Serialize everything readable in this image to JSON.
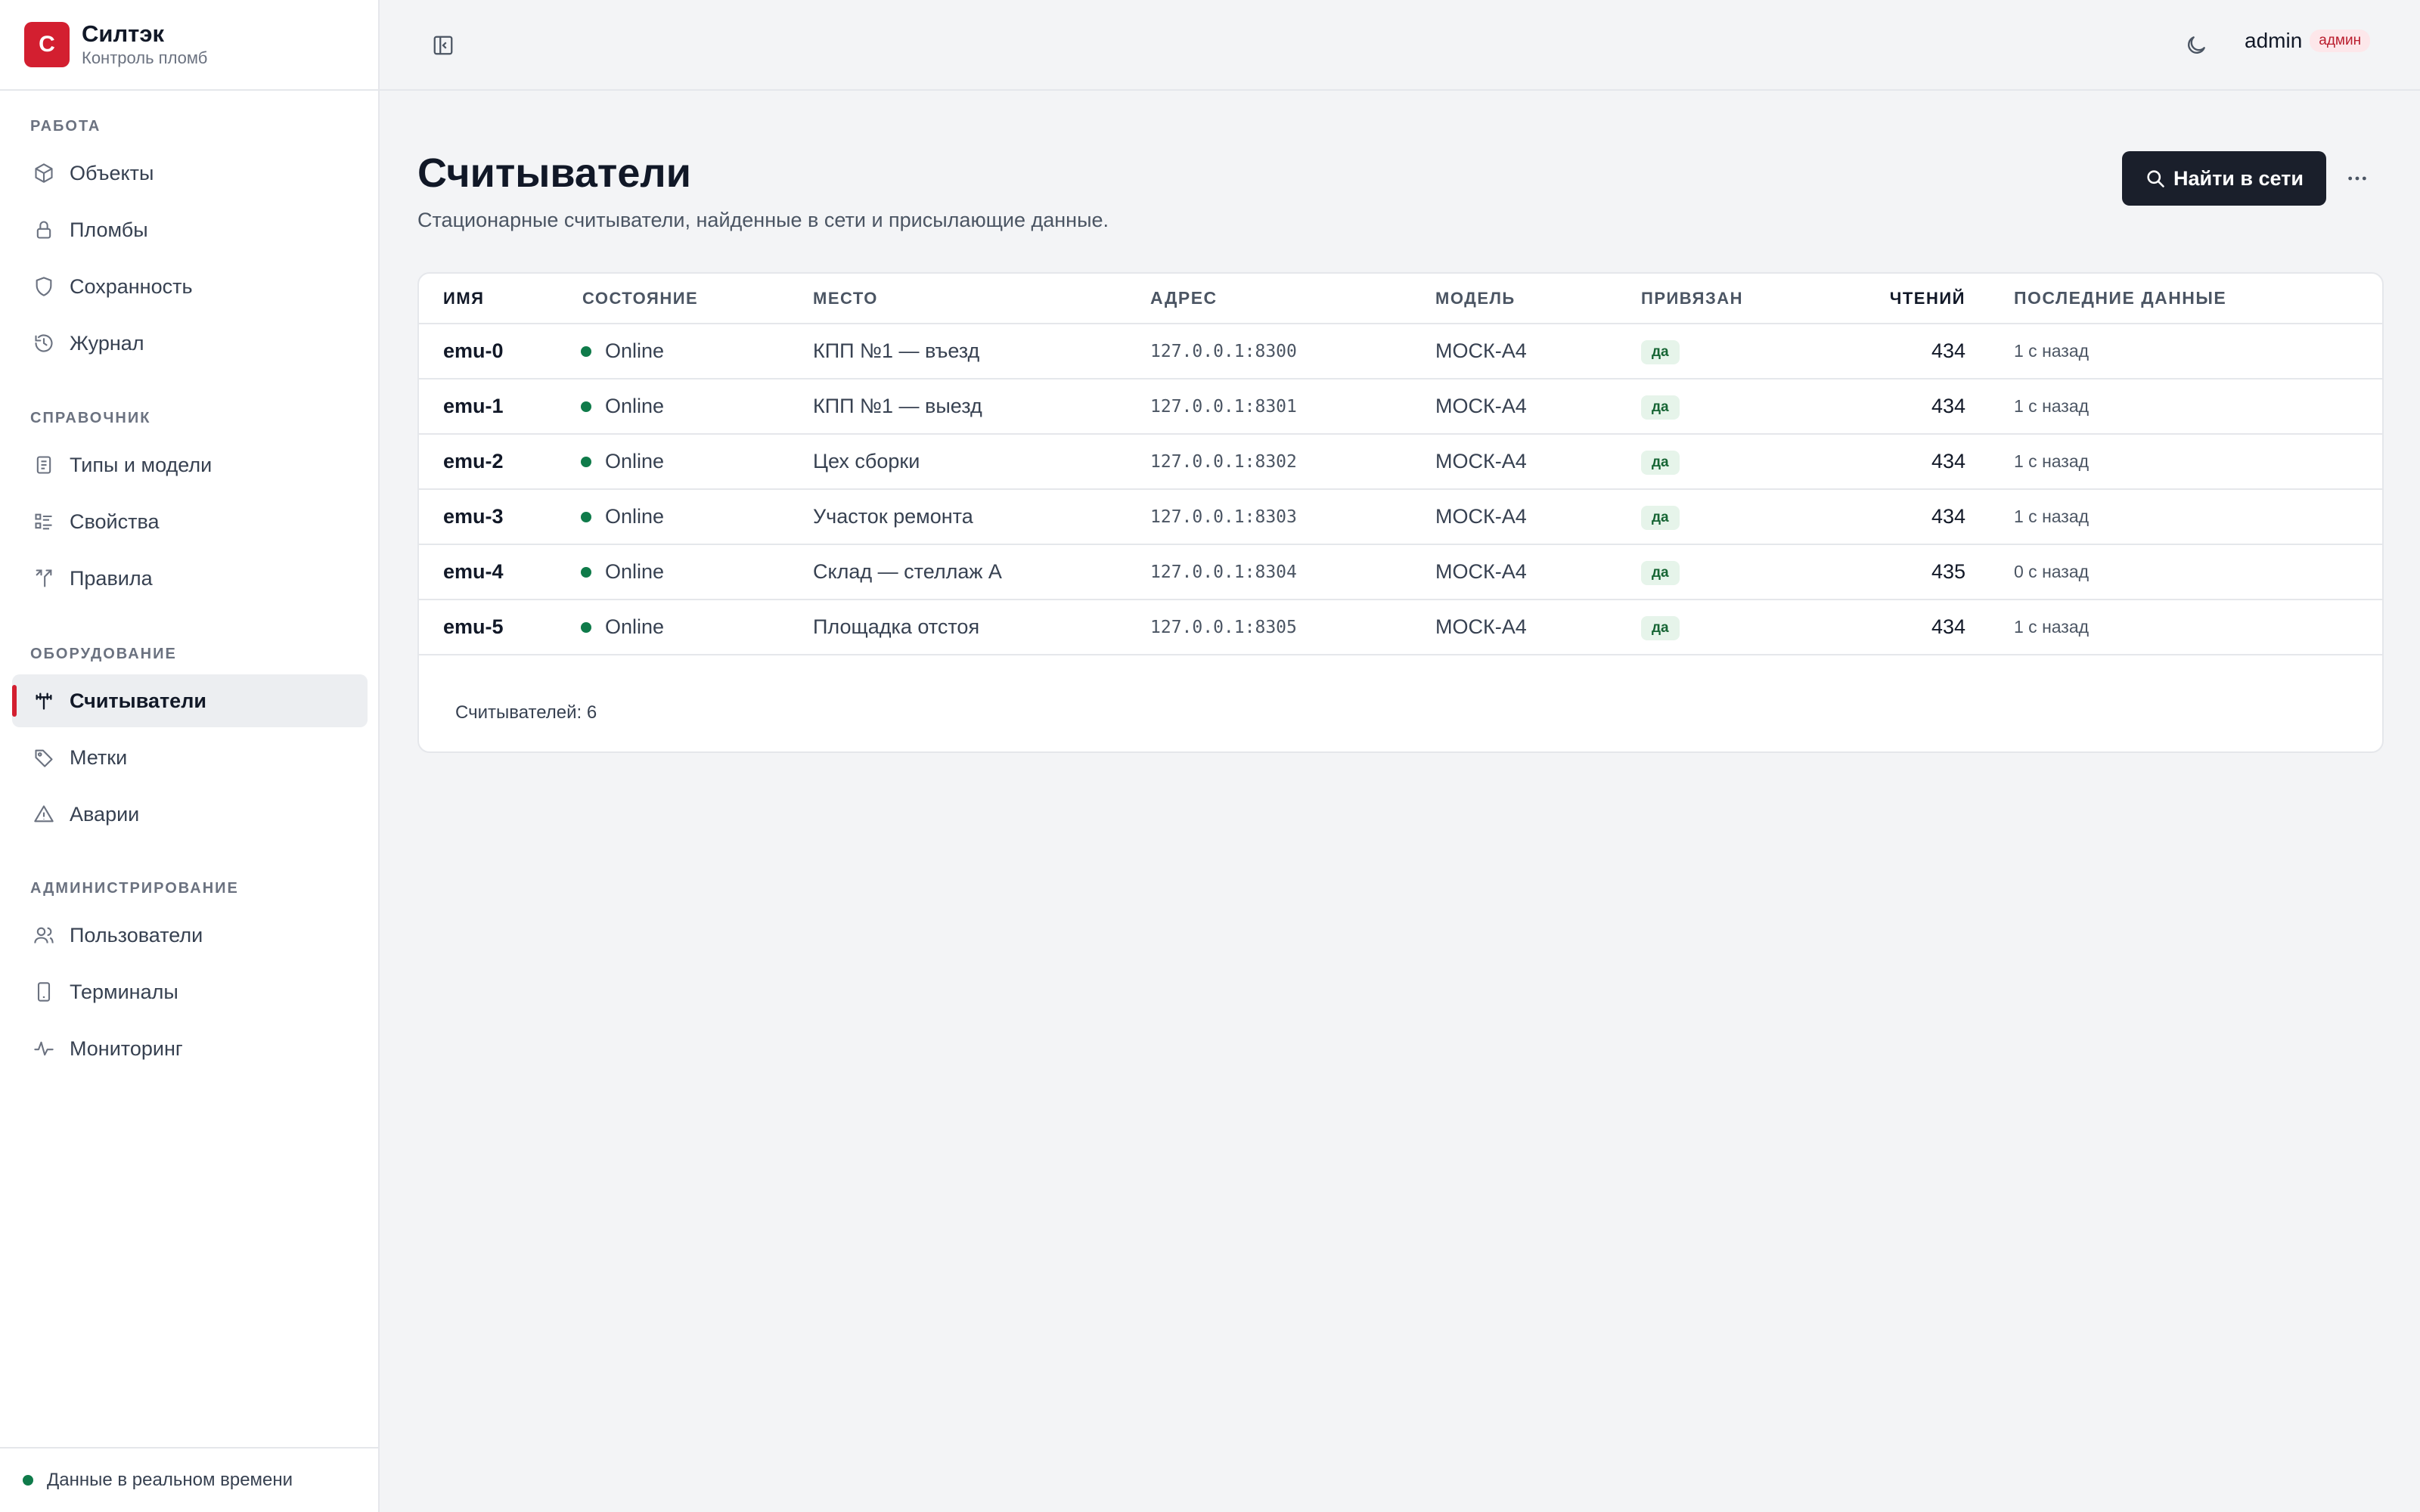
{
  "brand": {
    "logo_letter": "С",
    "name": "Силтэк",
    "subtitle": "Контроль пломб"
  },
  "sidebar": {
    "sections": [
      {
        "title": "РАБОТА",
        "items": [
          {
            "label": "Объекты",
            "icon": "cube-icon"
          },
          {
            "label": "Пломбы",
            "icon": "lock-icon"
          },
          {
            "label": "Сохранность",
            "icon": "shield-icon"
          },
          {
            "label": "Журнал",
            "icon": "history-icon"
          }
        ]
      },
      {
        "title": "СПРАВОЧНИК",
        "items": [
          {
            "label": "Типы и модели",
            "icon": "book-icon"
          },
          {
            "label": "Свойства",
            "icon": "list-icon"
          },
          {
            "label": "Правила",
            "icon": "split-icon"
          }
        ]
      },
      {
        "title": "ОБОРУДОВАНИЕ",
        "items": [
          {
            "label": "Считыватели",
            "icon": "antenna-icon",
            "active": true
          },
          {
            "label": "Метки",
            "icon": "tag-icon"
          },
          {
            "label": "Аварии",
            "icon": "warning-icon"
          }
        ]
      },
      {
        "title": "АДМИНИСТРИРОВАНИЕ",
        "items": [
          {
            "label": "Пользователи",
            "icon": "users-icon"
          },
          {
            "label": "Терминалы",
            "icon": "device-icon"
          },
          {
            "label": "Мониторинг",
            "icon": "pulse-icon"
          }
        ]
      }
    ],
    "footer": "Данные в реальном времени"
  },
  "header": {
    "user": "admin",
    "role": "админ"
  },
  "main": {
    "title": "Считыватели",
    "description": "Стационарные считыватели, найденные в сети и присылающие данные.",
    "primary_action": "Найти в сети",
    "table": {
      "columns": [
        "ИМЯ",
        "СОСТОЯНИЕ",
        "МЕСТО",
        "АДРЕС",
        "МОДЕЛЬ",
        "ПРИВЯЗАН",
        "ЧТЕНИЙ",
        "ПОСЛЕДНИЕ ДАННЫЕ"
      ],
      "rows": [
        {
          "name": "emu-0",
          "state": "Online",
          "place": "КПП №1 — въезд",
          "address": "127.0.0.1:8300",
          "model": "МОСК-А4",
          "bound": "да",
          "reads": "434",
          "last": "1 с назад"
        },
        {
          "name": "emu-1",
          "state": "Online",
          "place": "КПП №1 — выезд",
          "address": "127.0.0.1:8301",
          "model": "МОСК-А4",
          "bound": "да",
          "reads": "434",
          "last": "1 с назад"
        },
        {
          "name": "emu-2",
          "state": "Online",
          "place": "Цех сборки",
          "address": "127.0.0.1:8302",
          "model": "МОСК-А4",
          "bound": "да",
          "reads": "434",
          "last": "1 с назад"
        },
        {
          "name": "emu-3",
          "state": "Online",
          "place": "Участок ремонта",
          "address": "127.0.0.1:8303",
          "model": "МОСК-А4",
          "bound": "да",
          "reads": "434",
          "last": "1 с назад"
        },
        {
          "name": "emu-4",
          "state": "Online",
          "place": "Склад — стеллаж А",
          "address": "127.0.0.1:8304",
          "model": "МОСК-А4",
          "bound": "да",
          "reads": "435",
          "last": "0 с назад"
        },
        {
          "name": "emu-5",
          "state": "Online",
          "place": "Площадка отстоя",
          "address": "127.0.0.1:8305",
          "model": "МОСК-А4",
          "bound": "да",
          "reads": "434",
          "last": "1 с назад"
        }
      ],
      "footer": "Считывателей: 6"
    }
  },
  "colors": {
    "accent": "#d31f30",
    "online": "#0f7b4a",
    "primary_button": "#1a1f2b"
  }
}
